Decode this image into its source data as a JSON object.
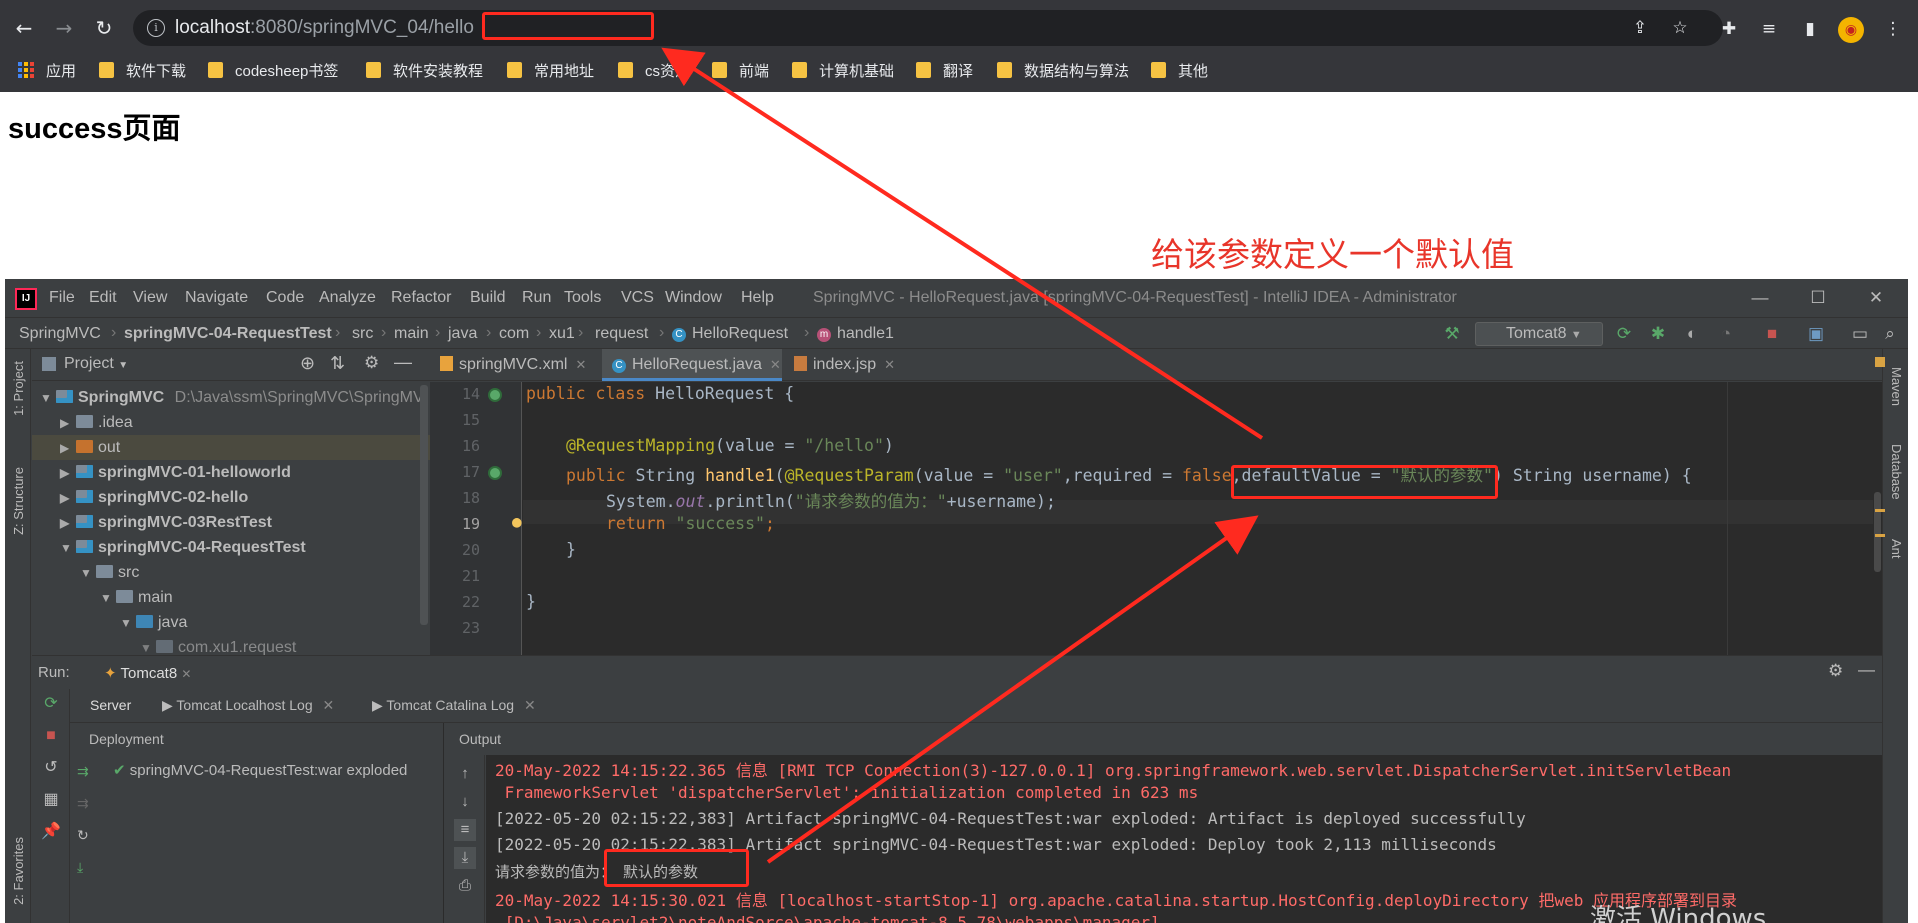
{
  "browser": {
    "url_host": "localhost",
    "url_path": ":8080/springMVC_04/hello",
    "bookmarks": [
      "应用",
      "软件下载",
      "codesheep书签",
      "软件安装教程",
      "常用地址",
      "cs资源",
      "前端",
      "计算机基础",
      "翻译",
      "数据结构与算法",
      "其他"
    ]
  },
  "page": {
    "title": "success页面"
  },
  "annotation": {
    "text": "给该参数定义一个默认值",
    "color": "#e8352a"
  },
  "ide": {
    "menus": [
      "File",
      "Edit",
      "View",
      "Navigate",
      "Code",
      "Analyze",
      "Refactor",
      "Build",
      "Run",
      "Tools",
      "VCS",
      "Window",
      "Help"
    ],
    "window_title": "SpringMVC - HelloRequest.java [springMVC-04-RequestTest] - IntelliJ IDEA - Administrator",
    "breadcrumbs": [
      "SpringMVC",
      "springMVC-04-RequestTest",
      "src",
      "main",
      "java",
      "com",
      "xu1",
      "request",
      "HelloRequest",
      "handle1"
    ],
    "run_config": "Tomcat8",
    "left_stripe": [
      "1: Project",
      "Z: Structure",
      "2: Favorites"
    ],
    "right_stripe": [
      "Maven",
      "Database",
      "Ant"
    ],
    "project": {
      "header": "Project",
      "root": "SpringMVC",
      "root_path": "D:\\Java\\ssm\\SpringMVC\\SpringMV",
      "nodes": [
        ".idea",
        "out",
        "springMVC-01-helloworld",
        "springMVC-02-hello",
        "springMVC-03RestTest",
        "springMVC-04-RequestTest",
        "src",
        "main",
        "java",
        "com.xu1.request"
      ]
    },
    "tabs": [
      "springMVC.xml",
      "HelloRequest.java",
      "index.jsp"
    ],
    "line_numbers": [
      "14",
      "15",
      "16",
      "17",
      "18",
      "19",
      "20",
      "21",
      "22",
      "23"
    ],
    "code": {
      "l14_kw": "public class ",
      "l14_name": "HelloRequest {",
      "l16_ann": "@RequestMapping",
      "l16_rest1": "(value = ",
      "l16_str": "\"/hello\"",
      "l16_rest2": ")",
      "l17_kw": "public ",
      "l17_type": "String ",
      "l17_fn": "handle1",
      "l17_p1": "(",
      "l17_ann": "@RequestParam",
      "l17_p2": "(value = ",
      "l17_s1": "\"user\"",
      "l17_p3": ",required = ",
      "l17_kw2": "false",
      "l17_p4": ",defaultValue = ",
      "l17_s2": "\"默认的参数\"",
      "l17_p5": ") String username) {",
      "l18_a": "System.",
      "l18_out": "out",
      "l18_b": ".println(",
      "l18_str": "\"请求参数的值为：\"",
      "l18_c": "+username);",
      "l19_kw": "return ",
      "l19_str": "\"success\"",
      "l19_end": ";",
      "l20": "}",
      "l22": "}"
    },
    "run": {
      "label": "Run:",
      "tab": "Tomcat8",
      "subtabs": [
        "Server",
        "Tomcat Localhost Log",
        "Tomcat Catalina Log"
      ],
      "deployment_header": "Deployment",
      "deployment_item": "springMVC-04-RequestTest:war exploded",
      "output_header": "Output",
      "lines": [
        "20-May-2022 14:15:22.365 信息 [RMI TCP Connection(3)-127.0.0.1] org.springframework.web.servlet.DispatcherServlet.initServletBean",
        " FrameworkServlet 'dispatcherServlet': initialization completed in 623 ms",
        "[2022-05-20 02:15:22,383] Artifact springMVC-04-RequestTest:war exploded: Artifact is deployed successfully",
        "[2022-05-20 02:15:22,383] Artifact springMVC-04-RequestTest:war exploded: Deploy took 2,113 milliseconds",
        "20-May-2022 14:15:30.021 信息 [localhost-startStop-1] org.apache.catalina.startup.HostConfig.deployDirectory 把web 应用程序部署到目录",
        " [D:\\Java\\servlet2\\noteAndSorce\\apache-tomcat-8.5.78\\webapps\\manager]"
      ],
      "param_label": "请求参数的值为：",
      "param_value": "默认的参数"
    }
  },
  "watermark": "激活 Windows"
}
